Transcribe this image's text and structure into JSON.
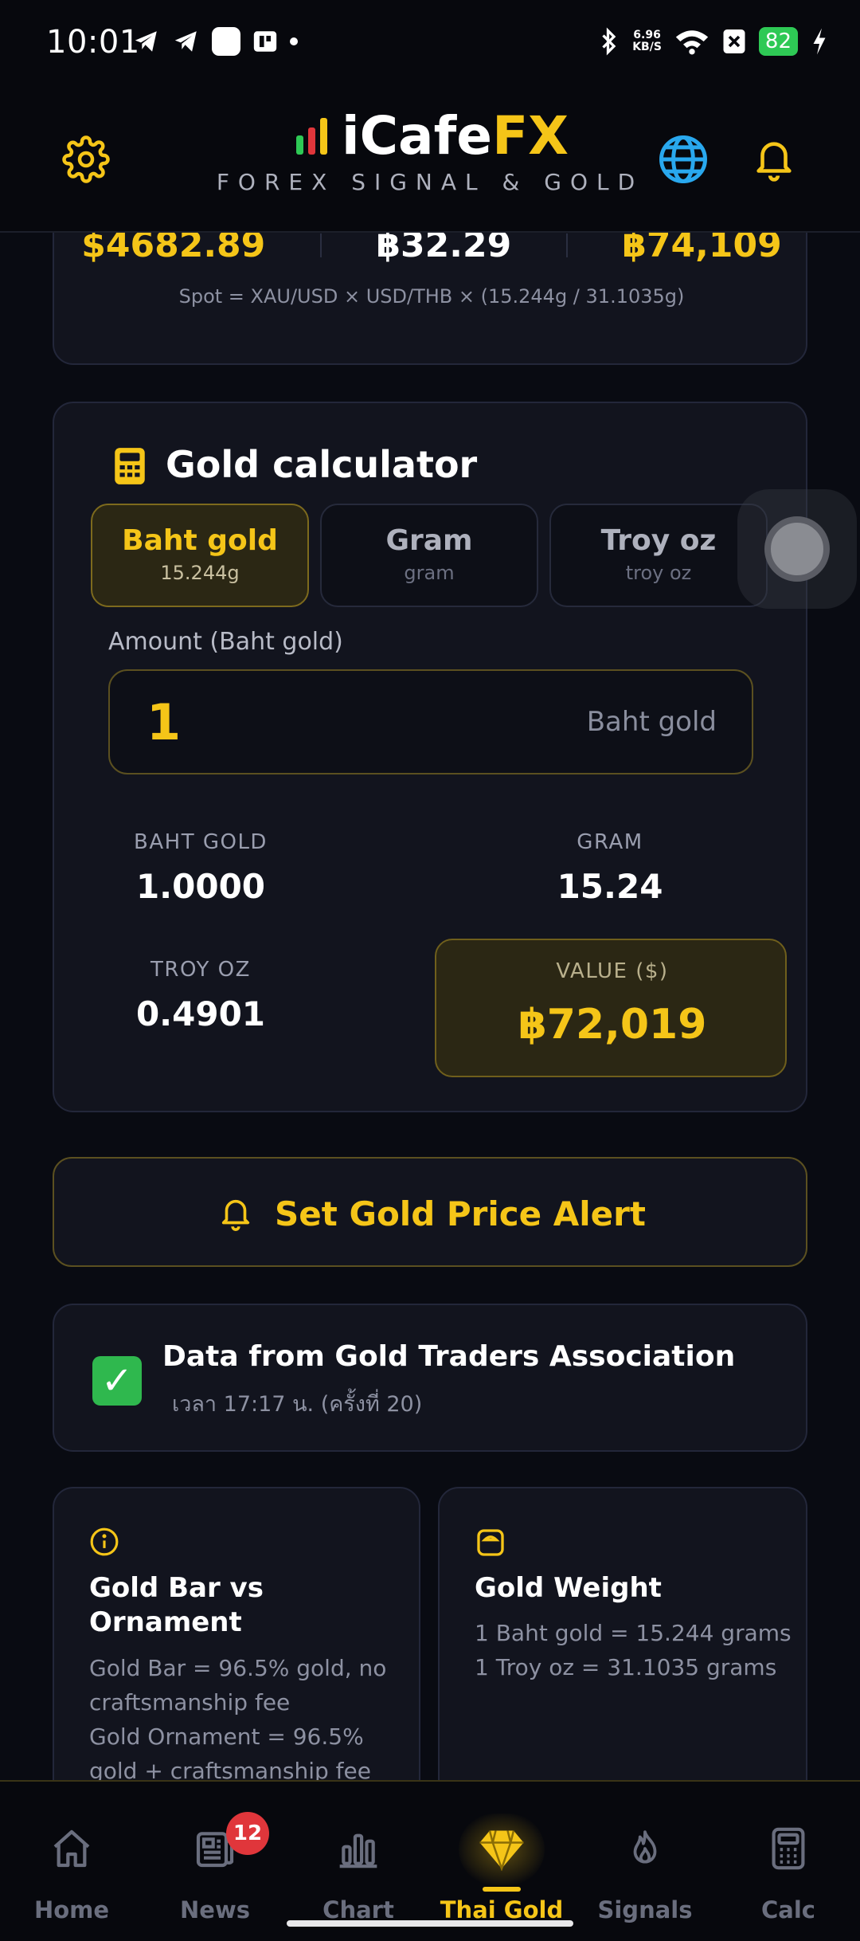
{
  "status_bar": {
    "time": "10:01",
    "net_speed_value": "6.96",
    "net_speed_unit": "KB/S",
    "battery": "82",
    "icons": [
      "telegram-icon",
      "telegram-icon",
      "app-icon",
      "app-icon",
      "dot-icon",
      "bluetooth-icon",
      "wifi-icon",
      "sim-off-icon",
      "battery-icon",
      "charging-icon"
    ]
  },
  "header": {
    "logo_main": "iCafe",
    "logo_accent": "FX",
    "tagline": "FOREX SIGNAL & GOLD",
    "colors": {
      "brand_gold": "#f5c518",
      "bar_green": "#2ec955",
      "bar_red": "#e0363b"
    }
  },
  "prices": {
    "spot_usd": "$4682.89",
    "rate_thb": "฿32.29",
    "spot_thb": "฿74,109",
    "formula": "Spot = XAU/USD × USD/THB × (15.244g / 31.1035g)"
  },
  "calculator": {
    "title": "Gold calculator",
    "units": [
      {
        "label": "Baht gold",
        "sub": "15.244g",
        "active": true
      },
      {
        "label": "Gram",
        "sub": "gram",
        "active": false
      },
      {
        "label": "Troy oz",
        "sub": "troy oz",
        "active": false
      }
    ],
    "amount_label": "Amount (Baht gold)",
    "amount_value": "1",
    "amount_unit": "Baht gold",
    "results": {
      "baht_gold_label": "BAHT GOLD",
      "baht_gold_value": "1.0000",
      "gram_label": "GRAM",
      "gram_value": "15.24",
      "troy_oz_label": "TROY OZ",
      "troy_oz_value": "0.4901",
      "value_label": "VALUE ($)",
      "value_value": "฿72,019"
    }
  },
  "alert_button": {
    "label": "Set Gold Price Alert"
  },
  "source": {
    "title": "Data from Gold Traders Association",
    "time": "เวลา 17:17 น. (ครั้งที่ 20)"
  },
  "info_cards": [
    {
      "title": "Gold Bar vs Ornament",
      "lines": [
        "Gold Bar = 96.5% gold, no",
        "craftsmanship fee",
        "Gold Ornament = 96.5%",
        "gold + craftsmanship fee"
      ]
    },
    {
      "title": "Gold Weight",
      "lines": [
        "1 Baht gold = 15.244 grams",
        "1 Troy oz = 31.1035 grams"
      ]
    }
  ],
  "bottom_nav": {
    "items": [
      {
        "label": "Home",
        "icon": "home-icon"
      },
      {
        "label": "News",
        "icon": "news-icon",
        "badge": "12"
      },
      {
        "label": "Chart",
        "icon": "bar-chart-icon"
      },
      {
        "label": "Thai Gold",
        "icon": "diamond-icon",
        "active": true
      },
      {
        "label": "Signals",
        "icon": "flame-icon"
      },
      {
        "label": "Calc",
        "icon": "calculator-icon"
      }
    ]
  }
}
